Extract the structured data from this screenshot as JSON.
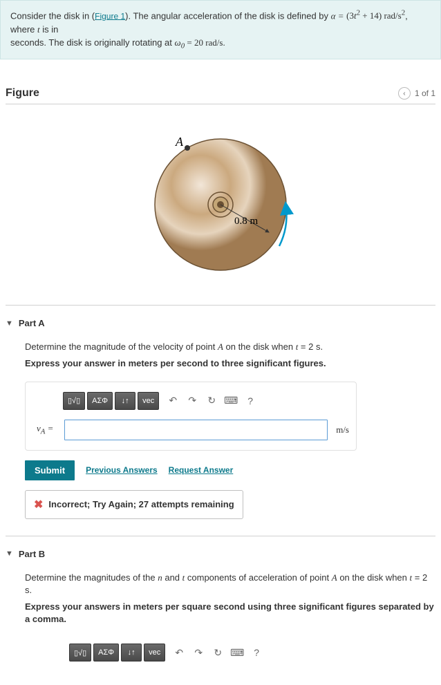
{
  "problem": {
    "line1_pre": "Consider the disk in (",
    "fig_link": "Figure 1",
    "line1_post": "). The angular acceleration of the disk is defined by ",
    "alpha_lhs": "α =",
    "alpha_rhs_open": "(3",
    "alpha_rhs_t": "t",
    "alpha_rhs_close": " + 14) rad/s",
    "sq": "2",
    "where_pre": ", where ",
    "where_t": "t",
    "where_post": " is in",
    "line2_pre": "seconds. The disk is originally rotating at ",
    "omega_sym": "ω",
    "omega_sub": "0",
    "omega_val": " = 20 rad/s."
  },
  "figure": {
    "title": "Figure",
    "pager_text": "1 of 1",
    "prev_glyph": "‹",
    "point_label": "A",
    "radius_label": "0.8 m"
  },
  "toolbar": {
    "template": "▯√▯",
    "greek": "ΑΣΦ",
    "sort": "↓↑",
    "vec": "vec",
    "undo": "↶",
    "redo": "↷",
    "reset": "↻",
    "keyboard": "⌨",
    "help": "?"
  },
  "partA": {
    "label": "Part A",
    "prompt_pre": "Determine the magnitude of the velocity of point ",
    "prompt_A": "A",
    "prompt_mid": " on the disk when ",
    "prompt_t": "t",
    "prompt_post": " = 2 s.",
    "instructions": "Express your answer in meters per second to three significant figures.",
    "var_v": "v",
    "var_sub": "A",
    "var_eq": " =",
    "unit": "m/s",
    "submit": "Submit",
    "prev_answers": "Previous Answers",
    "request_answer": "Request Answer",
    "feedback": "Incorrect; Try Again; 27 attempts remaining"
  },
  "partB": {
    "label": "Part B",
    "prompt_pre": "Determine the magnitudes of the ",
    "prompt_n": "n",
    "prompt_and": " and ",
    "prompt_t": "t",
    "prompt_mid": " components of acceleration of point ",
    "prompt_A": "A",
    "prompt_when": " on the disk when ",
    "prompt_t2": "t",
    "prompt_post": " = 2 s.",
    "instructions": "Express your answers in meters per square second using three significant figures separated by a comma."
  }
}
